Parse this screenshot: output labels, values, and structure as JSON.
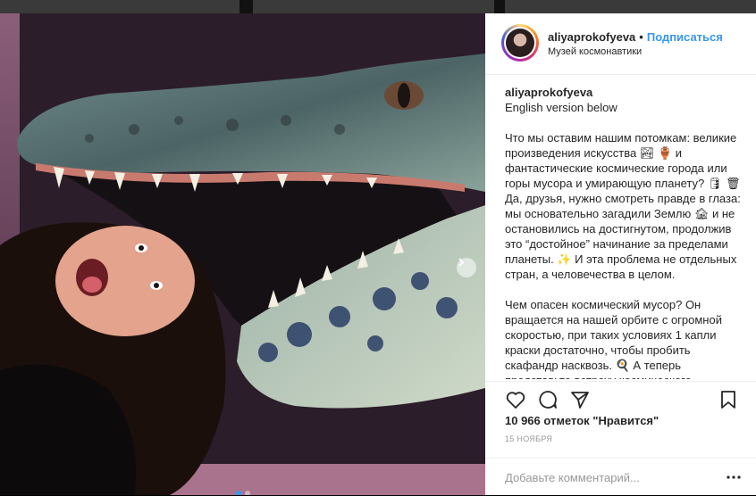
{
  "post": {
    "username": "aliyaprokofyeva",
    "separator": "•",
    "follow_label": "Подписаться",
    "location": "Музей космонавтики"
  },
  "caption": {
    "username": "aliyaprokofyeva",
    "paragraphs": [
      "English version below",
      "Что мы оставим нашим потомкам: великие произведения искусства 🏞 🏺 и фантастические космические города или горы мусора и умирающую планету? 🛢 🗑 Да, друзья, нужно смотреть правде в глаза: мы основательно загадили Землю 🏚 и не остановились на достигнутом, продолжив это “достойное” начинание за пределами планеты. ✨ И эта проблема не отдельных стран, а человечества в целом.",
      "Чем опасен космический мусор? Он вращается на нашей орбите с огромной скоростью, при таких условиях 1 капли краски достаточно, чтобы пробить скафандр насквозь. 🍳 А теперь представьте встречу космического"
    ]
  },
  "actions": {
    "like_icon": "heart-icon",
    "comment_icon": "comment-bubble-icon",
    "share_icon": "share-arrow-icon",
    "save_icon": "bookmark-icon"
  },
  "likes_text": "10 966 отметок \"Нравится\"",
  "date_text": "15 НОЯБРЯ",
  "comment": {
    "placeholder": "Добавьте комментарий...",
    "more_icon": "ellipsis-icon"
  },
  "carousel": {
    "total": 2,
    "current": 1,
    "next_icon": "chevron-right-icon"
  },
  "colors": {
    "accent": "#3897f0",
    "text": "#262626",
    "muted": "#999999",
    "border": "#efefef"
  }
}
